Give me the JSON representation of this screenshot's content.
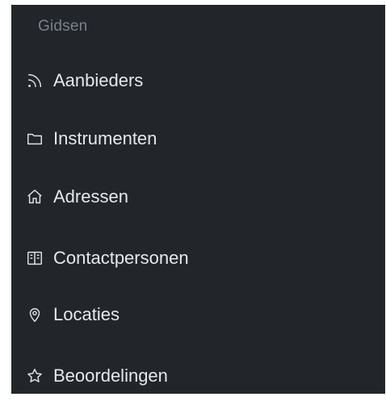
{
  "sidebar": {
    "section_title": "Gidsen",
    "items": [
      {
        "label": "Aanbieders",
        "icon": "rss-icon"
      },
      {
        "label": "Instrumenten",
        "icon": "folder-icon"
      },
      {
        "label": "Adressen",
        "icon": "home-icon"
      },
      {
        "label": "Contactpersonen",
        "icon": "address-book-icon"
      },
      {
        "label": "Locaties",
        "icon": "map-pin-icon"
      },
      {
        "label": "Beoordelingen",
        "icon": "star-icon"
      }
    ]
  },
  "colors": {
    "sidebar_background": "#22252a",
    "section_title": "#7c8088",
    "item_text": "#e6e8eb",
    "icon_stroke": "#dfe2e6"
  }
}
